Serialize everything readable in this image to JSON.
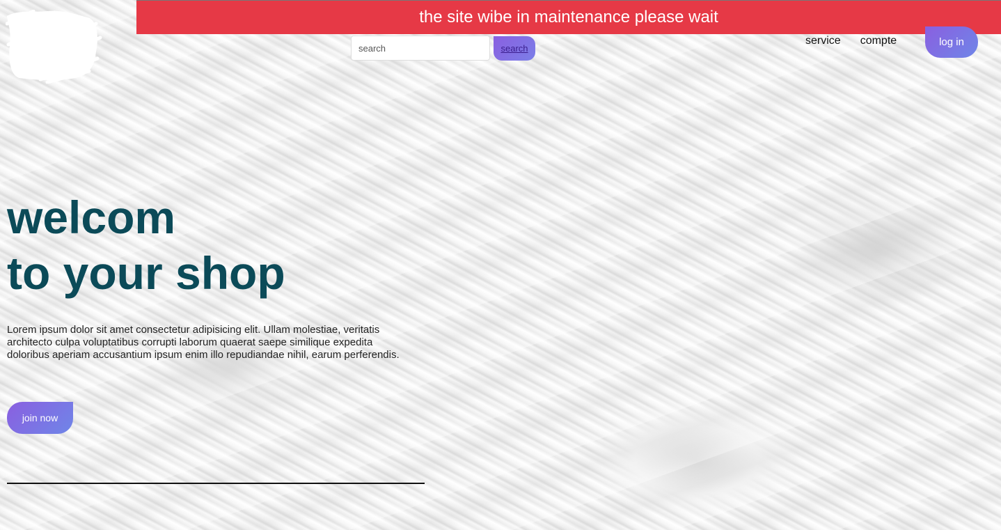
{
  "banner": {
    "text": "the site wibe in maintenance please wait",
    "color": "#e63946"
  },
  "logo": {
    "icon": "scribbled-logo-icon"
  },
  "search": {
    "placeholder": "search",
    "value": "",
    "button_label": "search"
  },
  "nav": {
    "items": [
      {
        "label": "service"
      },
      {
        "label": "compte"
      }
    ],
    "login_label": "log in"
  },
  "hero": {
    "title_line1": "welcom",
    "title_line2": "to your shop",
    "text": "Lorem ipsum dolor sit amet consectetur adipisicing elit. Ullam molestiae, veritatis architecto culpa voluptatibus corrupti laborum quaerat saepe similique expedita doloribus aperiam accusantium ipsum enim illo repudiandae nihil, earum perferendis.",
    "cta_label": "join now",
    "title_color": "#0b4a58"
  },
  "theme": {
    "accent_start": "#8a5fe0",
    "accent_end": "#6f86e8"
  }
}
